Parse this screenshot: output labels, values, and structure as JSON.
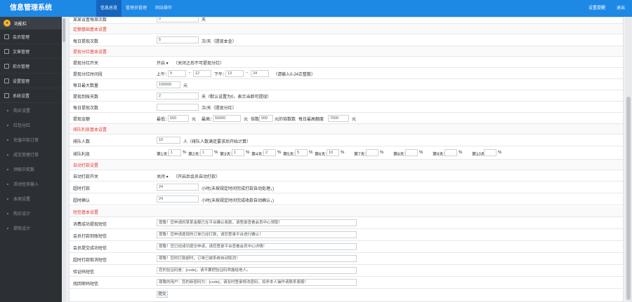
{
  "app": {
    "title": "信息管理系统"
  },
  "topnav": [
    {
      "label": "信息总览",
      "active": true
    },
    {
      "label": "管理员管理",
      "active": false
    },
    {
      "label": "网站操作",
      "active": false
    }
  ],
  "topright": {
    "settings": "设置提醒",
    "logout": "退出"
  },
  "sidebar": {
    "user_label": "功能栏",
    "items": [
      {
        "label": "会员管理",
        "icon": "user-icon"
      },
      {
        "label": "文章管理",
        "icon": "file-icon"
      },
      {
        "label": "前台管理",
        "icon": "monitor-icon"
      },
      {
        "label": "设置管理",
        "icon": "gear-icon"
      },
      {
        "label": "系统设置",
        "icon": "settings-icon"
      }
    ],
    "subitems": [
      "购买设置",
      "红包分红",
      "充值中奖订单",
      "成交受理订单",
      "领取中奖数",
      "活动任务输入",
      "本周设置",
      "购买设计",
      "提取设计"
    ]
  },
  "partial_row": {
    "label": "某某设置每周次数",
    "value": "0",
    "unit": "天"
  },
  "sec1": {
    "title": "定额基础基本设置",
    "label": "每日提现次数",
    "value": "5",
    "unit": "次/天（提现本金）"
  },
  "sec2": {
    "title": "提现分红基本设置",
    "switch": {
      "label": "提现分红开关",
      "value": "开启",
      "note": "（关闭之后不可提现分红）"
    },
    "time": {
      "label": "提现分红时间段",
      "am": "上午：",
      "am_from": "9",
      "am_to": "12",
      "pm": "下午：",
      "pm_from": "13",
      "pm_to": "24",
      "dash": "-",
      "note": "（请输入0-24正整数）"
    },
    "daily_max": {
      "label": "每日最大数量",
      "value": "100000",
      "unit": "元"
    },
    "hold_days": {
      "label": "提现到账天数",
      "value": "2",
      "note": "天（默认设置为0，表示当即可提现）"
    },
    "daily_count": {
      "label": "每日提现次数",
      "value": "",
      "note": "次/天（提现分红）"
    },
    "fee": {
      "label": "提现金额",
      "lowest": "最低：",
      "low_val": "500",
      "unit1": "元",
      "highest": "最高：",
      "high_val": "50000",
      "unit2": "元",
      "mult": "倍数",
      "mult_val": "500",
      "mult_note": "元的倍数数",
      "daily": "每日最高额度",
      "daily_val": "7000",
      "unit3": "元"
    }
  },
  "sec3": {
    "title": "排队利息基本设置",
    "people": {
      "label": "排队人数",
      "value": "10",
      "note": "人（排队人数满足要求后开始计算）"
    },
    "interest": {
      "label": "排队利息",
      "days": [
        {
          "d": "第1天：",
          "v": "1"
        },
        {
          "d": "第2天：",
          "v": "1"
        },
        {
          "d": "第3天：",
          "v": "1"
        },
        {
          "d": "第4天：",
          "v": "2"
        },
        {
          "d": "第5天：",
          "v": "5"
        },
        {
          "d": "第6天：",
          "v": "10"
        },
        {
          "d": "第7天：",
          "v": ""
        },
        {
          "d": "第8天：",
          "v": ""
        },
        {
          "d": "第9天：",
          "v": ""
        },
        {
          "d": "第10天：",
          "v": ""
        }
      ],
      "pct": "%"
    }
  },
  "sec4": {
    "title": "自动打款设置",
    "switch": {
      "label": "自动打款开关",
      "value": "关闭",
      "note": "（开启后会员自动打款）"
    },
    "close_time": {
      "label": "超时打款",
      "value": "24",
      "note": "小时(未按规定时间完成打款自动处理，)"
    },
    "confirm_time": {
      "label": "超时确认",
      "value": "24",
      "note": "小时(未按规定时间完成收款自动确认，)"
    }
  },
  "sec5": {
    "title": "短信基本设置",
    "rows": [
      {
        "label": "消费成功提现短信",
        "value": "尊敬！您申请的某某金额已在平台确认收款，请登录查看会员中心领取！"
      },
      {
        "label": "会员打款到账短信",
        "value": "尊敬！您申请提现的订单已经打款，请您登录平台进行确认！"
      },
      {
        "label": "会员提交成功短信",
        "value": "尊敬！您已经成功提交申请，请您登录平台查看会员中心详情！"
      },
      {
        "label": "超时打款取消短信",
        "value": "尊敬！您的打款超时，订单已被系统自动取消！"
      },
      {
        "label": "验证码短信",
        "value": "您的验证码是：[code]，请不要把验证码泄露给他人。"
      },
      {
        "label": "找回密码短信",
        "value": "尊敬的用户：您的新密码为：[code]，请及时登录修改密码，如非本人操作请联系客服！"
      }
    ]
  },
  "submit": "提交"
}
